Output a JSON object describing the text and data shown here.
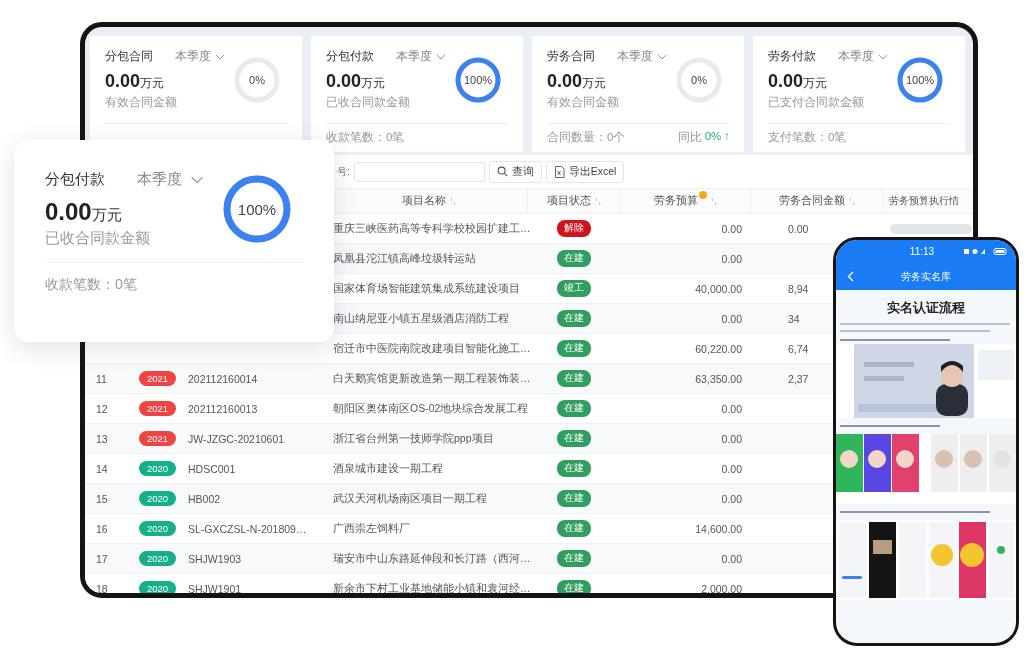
{
  "tablet": {
    "stat_cards": [
      {
        "title": "分包合同",
        "period": "本季度",
        "value": "0.00",
        "unit": "万元",
        "label": "有效合同金额",
        "ring": {
          "text": "0%",
          "level": 0
        }
      },
      {
        "title": "分包付款",
        "period": "本季度",
        "value": "0.00",
        "unit": "万元",
        "label": "已收合同款金额",
        "ring": {
          "text": "100%",
          "level": 1
        },
        "footer": {
          "count": "收款笔数：0笔"
        }
      },
      {
        "title": "劳务合同",
        "period": "本季度",
        "value": "0.00",
        "unit": "万元",
        "label": "有效合同金额",
        "ring": {
          "text": "0%",
          "level": 0
        },
        "footer": {
          "count": "合同数量：0个",
          "compare_label": "同比",
          "compare_value": "0%",
          "trend": "↑"
        }
      },
      {
        "title": "劳务付款",
        "period": "本季度",
        "value": "0.00",
        "unit": "万元",
        "label": "已支付合同款金额",
        "ring": {
          "text": "100%",
          "level": 1
        },
        "footer": {
          "count": "支付笔数：0笔"
        }
      }
    ],
    "toolbar": {
      "field_label": "号:",
      "buttons": [
        {
          "kind": "search",
          "label": "查询"
        },
        {
          "kind": "export",
          "label": "导出Excel"
        }
      ]
    },
    "table": {
      "columns": [
        {
          "label": "项目名称",
          "sortable": true,
          "hint": false
        },
        {
          "label": "项目状态",
          "sortable": true,
          "hint": false
        },
        {
          "label": "劳务预算",
          "sortable": true,
          "hint": true
        },
        {
          "label": "劳务合同金额",
          "sortable": true,
          "hint": false
        },
        {
          "label": "劳务预算执行情",
          "sortable": false,
          "hint": false
        }
      ],
      "rows": [
        {
          "name": "重庆三峡医药高等专科学校校园扩建工…",
          "status": {
            "text": "解除",
            "color": "#d0121b"
          },
          "budget": "0.00",
          "contract": "0.00",
          "execution": {
            "level": 0
          }
        },
        {
          "name": "凤凰县沱江镇高峰垃圾转运站",
          "status": {
            "text": "在建",
            "color": "#2f9e5f"
          },
          "budget": "0.00"
        },
        {
          "name": "国家体育场智能建筑集成系统建设项目",
          "status": {
            "text": "竣工",
            "color": "#2f9e5f"
          },
          "budget": "40,000.00",
          "contract": "8,94"
        },
        {
          "name": "南山纳尼亚小镇五星级酒店消防工程",
          "status": {
            "text": "在建",
            "color": "#2f9e5f"
          },
          "budget": "0.00",
          "contract": "34"
        },
        {
          "name": "宿迁市中医院南院改建项目智能化施工…",
          "status": {
            "text": "在建",
            "color": "#2f9e5f"
          },
          "budget": "60,220.00",
          "contract": "6,74"
        },
        {
          "no": "11",
          "year": {
            "text": "2021",
            "color": "#ef4444"
          },
          "code": "202112160014",
          "name": "白天鹅宾馆更新改造第一期工程装饰装…",
          "status": {
            "text": "在建",
            "color": "#2f9e5f"
          },
          "budget": "63,350.00",
          "contract": "2,37"
        },
        {
          "no": "12",
          "year": {
            "text": "2021",
            "color": "#ef4444"
          },
          "code": "202112160013",
          "name": "朝阳区奥体南区OS-02地块综合发展工程",
          "status": {
            "text": "在建",
            "color": "#2f9e5f"
          },
          "budget": "0.00"
        },
        {
          "no": "13",
          "year": {
            "text": "2021",
            "color": "#ef4444"
          },
          "code": "JW-JZGC-20210601",
          "name": "浙江省台州第一技师学院ppp项目",
          "status": {
            "text": "在建",
            "color": "#2f9e5f"
          },
          "budget": "0.00"
        },
        {
          "no": "14",
          "year": {
            "text": "2020",
            "color": "#14b08a"
          },
          "code": "HDSC001",
          "name": "酒泉城市建设一期工程",
          "status": {
            "text": "在建",
            "color": "#2f9e5f"
          },
          "budget": "0.00"
        },
        {
          "no": "15",
          "year": {
            "text": "2020",
            "color": "#14b08a"
          },
          "code": "HB002",
          "name": "武汉天河机场南区项目一期工程",
          "status": {
            "text": "在建",
            "color": "#2f9e5f"
          },
          "budget": "0.00"
        },
        {
          "no": "16",
          "year": {
            "text": "2020",
            "color": "#14b08a"
          },
          "code": "SL-GXCZSL-N-201809…",
          "name": "广西崇左饲料厂",
          "status": {
            "text": "在建",
            "color": "#2f9e5f"
          },
          "budget": "14,600.00"
        },
        {
          "no": "17",
          "year": {
            "text": "2020",
            "color": "#14b08a"
          },
          "code": "SHJW1903",
          "name": "瑞安市中山东路延伸段和长汀路（西河…",
          "status": {
            "text": "在建",
            "color": "#2f9e5f"
          },
          "budget": "0.00"
        },
        {
          "no": "18",
          "year": {
            "text": "2020",
            "color": "#14b08a"
          },
          "code": "SHJW1901",
          "name": "新余市下村工业基地储能小镇和袁河经…",
          "status": {
            "text": "在建",
            "color": "#2f9e5f"
          },
          "budget": "2,000.00"
        }
      ]
    }
  },
  "floating_card": {
    "title": "分包付款",
    "period": "本季度",
    "value": "0.00",
    "unit": "万元",
    "label": "已收合同款金额",
    "ring": {
      "text": "100%",
      "level": 1
    },
    "footer": {
      "count": "收款笔数：0笔"
    }
  },
  "phone": {
    "status_bar": {
      "time": "11:13"
    },
    "nav": {
      "title": "劳务实名库"
    },
    "article": {
      "title": "实名认证流程"
    }
  }
}
